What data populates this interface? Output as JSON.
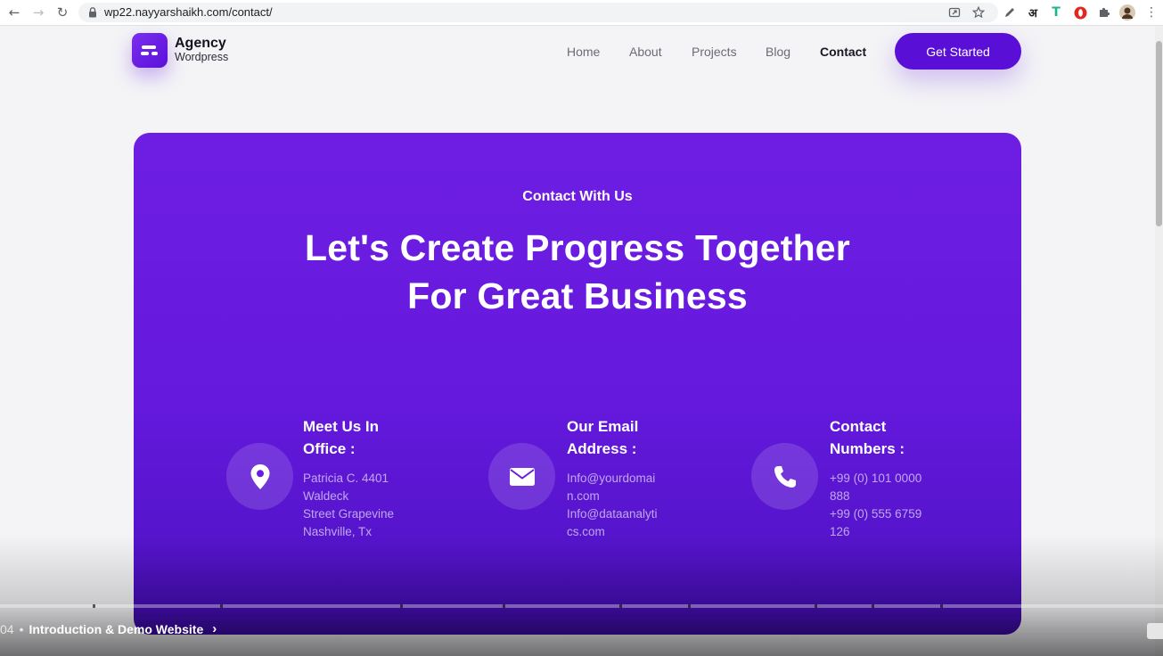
{
  "browser": {
    "url": "wp22.nayyarshaikh.com/contact/",
    "extension_hindi": "अ",
    "extension_t": "T"
  },
  "header": {
    "logo_title": "Agency",
    "logo_subtitle": "Wordpress",
    "nav": {
      "home": "Home",
      "about": "About",
      "projects": "Projects",
      "blog": "Blog",
      "contact": "Contact"
    },
    "cta_label": "Get Started"
  },
  "hero": {
    "kicker": "Contact With Us",
    "headline_line1": "Let's Create Progress Together",
    "headline_line2": "For Great Business"
  },
  "info": {
    "office": {
      "title_line1": "Meet Us In",
      "title_line2": "Office :",
      "line1": "Patricia C. 4401",
      "line2": "Waldeck",
      "line3": "Street Grapevine",
      "line4": "Nashville, Tx"
    },
    "email": {
      "title_line1": "Our Email",
      "title_line2": "Address :",
      "line1": "Info@yourdomai",
      "line2": "n.com",
      "line3": "Info@dataanalyti",
      "line4": "cs.com"
    },
    "phone": {
      "title_line1": "Contact",
      "title_line2": "Numbers :",
      "line1": "+99 (0) 101 0000",
      "line2": "888",
      "line3": "+99 (0) 555 6759",
      "line4": "126"
    }
  },
  "video": {
    "time": "04",
    "chapter": "Introduction & Demo Website"
  },
  "colors": {
    "brand": "#5a0fd6",
    "hero_top": "#6e1ee3",
    "hero_bottom": "#3d0aa6"
  }
}
